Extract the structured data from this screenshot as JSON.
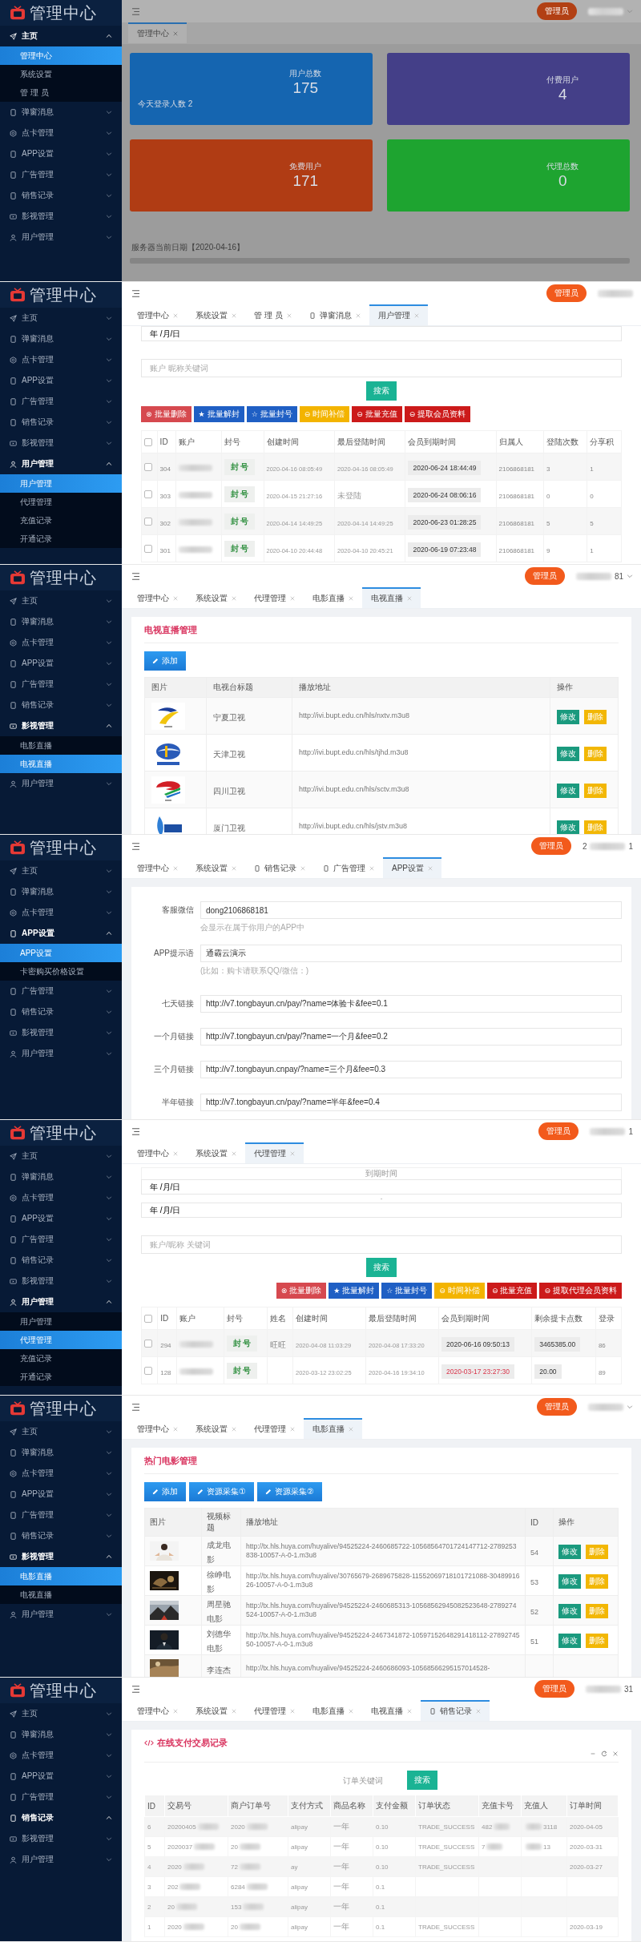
{
  "panels": [
    {
      "kind": "dashboard",
      "sidebar": {
        "logo": "管理中心",
        "items": [
          {
            "label": "主页",
            "expanded": true,
            "children": [
              {
                "label": "管理中心",
                "selected": true
              },
              {
                "label": "系统设置",
                "selected": false
              },
              {
                "label": "管 理 员",
                "selected": false
              }
            ]
          },
          {
            "label": "弹窗消息",
            "expanded": false
          },
          {
            "label": "点卡管理",
            "expanded": false
          },
          {
            "label": "APP设置",
            "expanded": false
          },
          {
            "label": "广告管理",
            "expanded": false
          },
          {
            "label": "销售记录",
            "expanded": false
          },
          {
            "label": "影视管理",
            "expanded": false
          },
          {
            "label": "用户管理",
            "expanded": false
          }
        ]
      },
      "header": {
        "role": "管理员",
        "dropdown": true
      },
      "tabs": [
        {
          "label": "管理中心",
          "selected": true,
          "has_icon": false
        }
      ],
      "body": {
        "stats": [
          {
            "label": "用户总数",
            "value": "175",
            "color": "#1565b0",
            "note": "今天登录人数 2"
          },
          {
            "label": "付费用户",
            "value": "4",
            "color": "#443f88"
          },
          {
            "label": "免费用户",
            "value": "171",
            "color": "#b03c14"
          },
          {
            "label": "代理总数",
            "value": "0",
            "color": "#1ea430"
          }
        ],
        "footer": "服务器当前日期【2020-04-16】"
      }
    },
    {
      "kind": "user_list",
      "sidebar": {
        "logo": "管理中心",
        "items": [
          {
            "label": "主页",
            "expanded": false
          },
          {
            "label": "弹窗消息",
            "expanded": false
          },
          {
            "label": "点卡管理",
            "expanded": false
          },
          {
            "label": "APP设置",
            "expanded": false
          },
          {
            "label": "广告管理",
            "expanded": false
          },
          {
            "label": "销售记录",
            "expanded": false
          },
          {
            "label": "影视管理",
            "expanded": false
          },
          {
            "label": "用户管理",
            "expanded": true,
            "children": [
              {
                "label": "用户管理",
                "selected": true
              },
              {
                "label": "代理管理",
                "selected": false
              },
              {
                "label": "充值记录",
                "selected": false
              },
              {
                "label": "开通记录",
                "selected": false
              }
            ]
          }
        ]
      },
      "header": {
        "role": "管理员",
        "dropdown": false
      },
      "tabs": [
        {
          "label": "管理中心",
          "selected": false,
          "has_icon": false
        },
        {
          "label": "系统设置",
          "selected": false,
          "has_icon": false
        },
        {
          "label": "管 理 员",
          "selected": false,
          "has_icon": false
        },
        {
          "label": "弹窗消息",
          "selected": false,
          "has_icon": true
        },
        {
          "label": "用户管理",
          "selected": true,
          "has_icon": false
        }
      ],
      "body": {
        "date_from": "年 /月/日",
        "keyword_placeholder": "账户 昵称关键词",
        "search": "搜索",
        "batch": [
          {
            "glyph": "⊗",
            "label": "批量删除",
            "color": "#d6494f"
          },
          {
            "glyph": "★",
            "label": "批量解封",
            "color": "#1f5fc4"
          },
          {
            "glyph": "☆",
            "label": "批量封号",
            "color": "#1f5fc4"
          },
          {
            "glyph": "⊖",
            "label": "时间补偿",
            "color": "#f3b400"
          },
          {
            "glyph": "⊖",
            "label": "批量充值",
            "color": "#cc1a1a"
          },
          {
            "glyph": "⊖",
            "label": "提取会员资料",
            "color": "#cc1a1a"
          }
        ],
        "all_checked": false,
        "columns": [
          "ID",
          "账户",
          "封号",
          "创建时间",
          "最后登陆时间",
          "会员到期时间",
          "归属人",
          "登陆次数",
          "分享积"
        ],
        "rows": [
          {
            "checked": false,
            "id": "304",
            "ban": "封 号",
            "created": "2020-04-16 08:05:49",
            "last_login": "2020-04-16 08:05:49",
            "expires": "2020-06-24 18:44:49",
            "expired": false,
            "owner": "2106868181",
            "logins": "3",
            "share": "1"
          },
          {
            "checked": false,
            "id": "303",
            "ban": "封 号",
            "created": "2020-04-15 21:27:16",
            "last_login": "未登陆",
            "expires": "2020-06-24 08:06:16",
            "expired": false,
            "owner": "2106868181",
            "logins": "0",
            "share": "0"
          },
          {
            "checked": false,
            "id": "302",
            "ban": "封 号",
            "created": "2020-04-14 14:49:25",
            "last_login": "2020-04-14 14:49:25",
            "expires": "2020-06-23 01:28:25",
            "expired": false,
            "owner": "2106868181",
            "logins": "5",
            "share": "5"
          },
          {
            "checked": false,
            "id": "301",
            "ban": "封 号",
            "created": "2020-04-10 20:44:48",
            "last_login": "2020-04-10 20:45:21",
            "expires": "2020-06-19 07:23:48",
            "expired": false,
            "owner": "2106868181",
            "logins": "9",
            "share": "1"
          }
        ]
      }
    },
    {
      "kind": "media_list",
      "sidebar": {
        "logo": "管理中心",
        "items": [
          {
            "label": "主页",
            "expanded": false
          },
          {
            "label": "弹窗消息",
            "expanded": false
          },
          {
            "label": "点卡管理",
            "expanded": false
          },
          {
            "label": "APP设置",
            "expanded": false
          },
          {
            "label": "广告管理",
            "expanded": false
          },
          {
            "label": "销售记录",
            "expanded": false
          },
          {
            "label": "影视管理",
            "expanded": true,
            "children": [
              {
                "label": "电影直播",
                "selected": false
              },
              {
                "label": "电视直播",
                "selected": true
              }
            ]
          },
          {
            "label": "用户管理",
            "expanded": false
          }
        ]
      },
      "header": {
        "role": "管理员",
        "user_suffix": "81",
        "dropdown": true
      },
      "tabs": [
        {
          "label": "管理中心",
          "selected": false,
          "has_icon": false
        },
        {
          "label": "系统设置",
          "selected": false,
          "has_icon": false
        },
        {
          "label": "代理管理",
          "selected": false,
          "has_icon": false
        },
        {
          "label": "电影直播",
          "selected": false,
          "has_icon": false
        },
        {
          "label": "电视直播",
          "selected": true,
          "has_icon": false
        }
      ],
      "body": {
        "title": "电视直播管理",
        "buttons": [
          "添加"
        ],
        "columns": [
          "图片",
          "电视台标题",
          "播放地址",
          "操作"
        ],
        "rows": [
          {
            "name": "宁夏卫视",
            "url": "http://ivi.bupt.edu.cn/hls/nxtv.m3u8",
            "edit": "修改",
            "delete": "删除"
          },
          {
            "name": "天津卫视",
            "url": "http://ivi.bupt.edu.cn/hls/tjhd.m3u8",
            "edit": "修改",
            "delete": "删除"
          },
          {
            "name": "四川卫视",
            "url": "http://ivi.bupt.edu.cn/hls/sctv.m3u8",
            "edit": "修改",
            "delete": "删除"
          },
          {
            "name": "厦门卫视",
            "url": "http://ivi.bupt.edu.cn/hls/jstv.m3u8",
            "edit": "修改",
            "delete": "删除"
          }
        ]
      }
    },
    {
      "kind": "app_settings",
      "sidebar": {
        "logo": "管理中心",
        "items": [
          {
            "label": "主页",
            "expanded": false
          },
          {
            "label": "弹窗消息",
            "expanded": false
          },
          {
            "label": "点卡管理",
            "expanded": false
          },
          {
            "label": "APP设置",
            "expanded": true,
            "children": [
              {
                "label": "APP设置",
                "selected": true
              },
              {
                "label": "卡密购买价格设置",
                "selected": false
              }
            ]
          },
          {
            "label": "广告管理",
            "expanded": false
          },
          {
            "label": "销售记录",
            "expanded": false
          },
          {
            "label": "影视管理",
            "expanded": false
          },
          {
            "label": "用户管理",
            "expanded": false
          }
        ]
      },
      "header": {
        "role": "管理员",
        "user_prefix": "2",
        "user_suffix": "1",
        "dropdown": false
      },
      "tabs": [
        {
          "label": "管理中心",
          "selected": false,
          "has_icon": false
        },
        {
          "label": "系统设置",
          "selected": false,
          "has_icon": false
        },
        {
          "label": "销售记录",
          "selected": false,
          "has_icon": true
        },
        {
          "label": "广告管理",
          "selected": false,
          "has_icon": true
        },
        {
          "label": "APP设置",
          "selected": true,
          "has_icon": false
        }
      ],
      "body": {
        "fields": [
          {
            "label": "客服微信",
            "value": "dong2106868181",
            "hint": "会显示在属于你用户的APP中"
          },
          {
            "label": "APP提示语",
            "value": "通霸云演示",
            "hint": "(比如：购卡请联系QQ/微信：)"
          },
          {
            "label": "七天链接",
            "value": "http://v7.tongbayun.cn/pay/?name=体验卡&fee=0.1"
          },
          {
            "label": "一个月链接",
            "value": "http://v7.tongbayun.cn/pay/?name=一个月&fee=0.2"
          },
          {
            "label": "三个月链接",
            "value": "http://v7.tongbayun.cnpay/?name=三个月&fee=0.3"
          },
          {
            "label": "半年链接",
            "value": "http://v7.tongbayun.cn/pay/?name=半年&fee=0.4"
          }
        ]
      }
    },
    {
      "kind": "agent_list",
      "sidebar": {
        "logo": "管理中心",
        "items": [
          {
            "label": "主页",
            "expanded": false
          },
          {
            "label": "弹窗消息",
            "expanded": false
          },
          {
            "label": "点卡管理",
            "expanded": false
          },
          {
            "label": "APP设置",
            "expanded": false
          },
          {
            "label": "广告管理",
            "expanded": false
          },
          {
            "label": "销售记录",
            "expanded": false
          },
          {
            "label": "影视管理",
            "expanded": false
          },
          {
            "label": "用户管理",
            "expanded": true,
            "children": [
              {
                "label": "用户管理",
                "selected": false
              },
              {
                "label": "代理管理",
                "selected": true
              },
              {
                "label": "充值记录",
                "selected": false
              },
              {
                "label": "开通记录",
                "selected": false
              }
            ]
          }
        ]
      },
      "header": {
        "role": "管理员",
        "user_suffix": "1",
        "dropdown": false
      },
      "tabs": [
        {
          "label": "管理中心",
          "selected": false,
          "has_icon": false
        },
        {
          "label": "系统设置",
          "selected": false,
          "has_icon": false
        },
        {
          "label": "代理管理",
          "selected": true,
          "has_icon": false
        }
      ],
      "body": {
        "expiry_label": "到期时间",
        "date_from": "年 /月/日",
        "separator": "-",
        "date_to": "年 /月/日",
        "keyword_placeholder": "账户/昵称 关键词",
        "search": "搜索",
        "batch": [
          {
            "glyph": "⊗",
            "label": "批量删除",
            "color": "#d6494f"
          },
          {
            "glyph": "★",
            "label": "批量解封",
            "color": "#1f5fc4"
          },
          {
            "glyph": "☆",
            "label": "批量封号",
            "color": "#1f5fc4"
          },
          {
            "glyph": "⊖",
            "label": "时间补偿",
            "color": "#f3b400"
          },
          {
            "glyph": "⊖",
            "label": "批量充值",
            "color": "#cc1a1a"
          },
          {
            "glyph": "⊖",
            "label": "提取代理会员资料",
            "color": "#cc1a1a"
          }
        ],
        "all_checked": false,
        "columns": [
          "ID",
          "账户",
          "封号",
          "姓名",
          "创建时间",
          "最后登陆时间",
          "会员到期时间",
          "剩余提卡点数",
          "登录"
        ],
        "rows": [
          {
            "checked": false,
            "id": "294",
            "ban": "封 号",
            "name": "旺旺",
            "created": "2020-04-08 11:03:29",
            "last_login": "2020-04-08 17:33:20",
            "expires": "2020-06-16 09:50:13",
            "expired": false,
            "points": "3465385.00",
            "logins": "86"
          },
          {
            "checked": false,
            "id": "128",
            "ban": "封 号",
            "created": "2020-03-12 23:02:25",
            "last_login": "2020-04-16 19:34:10",
            "expires": "2020-03-17 23:27:30",
            "expired": true,
            "points": "20.00",
            "logins": "89"
          }
        ]
      }
    },
    {
      "kind": "media_list",
      "sidebar": {
        "logo": "管理中心",
        "items": [
          {
            "label": "主页",
            "expanded": false
          },
          {
            "label": "弹窗消息",
            "expanded": false
          },
          {
            "label": "点卡管理",
            "expanded": false
          },
          {
            "label": "APP设置",
            "expanded": false
          },
          {
            "label": "广告管理",
            "expanded": false
          },
          {
            "label": "销售记录",
            "expanded": false
          },
          {
            "label": "影视管理",
            "expanded": true,
            "children": [
              {
                "label": "电影直播",
                "selected": true
              },
              {
                "label": "电视直播",
                "selected": false
              }
            ]
          },
          {
            "label": "用户管理",
            "expanded": false
          }
        ]
      },
      "header": {
        "role": "管理员",
        "dropdown": true
      },
      "tabs": [
        {
          "label": "管理中心",
          "selected": false,
          "has_icon": false
        },
        {
          "label": "系统设置",
          "selected": false,
          "has_icon": false
        },
        {
          "label": "代理管理",
          "selected": false,
          "has_icon": false
        },
        {
          "label": "电影直播",
          "selected": true,
          "has_icon": false
        }
      ],
      "body": {
        "title": "热门电影管理",
        "buttons": [
          "添加",
          "资源采集①",
          "资源采集②"
        ],
        "columns": [
          "图片",
          "视频标题",
          "播放地址",
          "ID",
          "操作"
        ],
        "rows": [
          {
            "name": "成龙电影",
            "url": "http://tx.hls.huya.com/huyalive/94525224-2460685722-10568564701724147712-2789253838-10057-A-0-1.m3u8",
            "id": "54",
            "edit": "修改",
            "delete": "删除"
          },
          {
            "name": "徐峥电影",
            "url": "http://tx.hls.huya.com/huyalive/30765679-2689675828-11552069718101721088-3048991626-10057-A-0-1.m3u8",
            "id": "53",
            "edit": "修改",
            "delete": "删除"
          },
          {
            "name": "周星驰电影",
            "url": "http://tx.hls.huya.com/huyalive/94525224-2460685313-10568562945082523648-2789274524-10057-A-0-1.m3u8",
            "id": "52",
            "edit": "修改",
            "delete": "删除"
          },
          {
            "name": "刘德华电影",
            "url": "http://tx.hls.huya.com/huyalive/94525224-2467341872-10597152648291418112-2789274550-10057-A-0-1.m3u8",
            "id": "51",
            "edit": "修改",
            "delete": "删除"
          },
          {
            "name": "李连杰",
            "url": "http://tx.hls.huya.com/huyalive/94525224-2460686093-10568566295157014528-"
          }
        ]
      }
    },
    {
      "kind": "sales",
      "sidebar": {
        "logo": "管理中心",
        "items": [
          {
            "label": "主页",
            "expanded": false
          },
          {
            "label": "弹窗消息",
            "expanded": false
          },
          {
            "label": "点卡管理",
            "expanded": false
          },
          {
            "label": "APP设置",
            "expanded": false
          },
          {
            "label": "广告管理",
            "expanded": false
          },
          {
            "label": "销售记录",
            "expanded": true
          },
          {
            "label": "影视管理",
            "expanded": false
          },
          {
            "label": "用户管理",
            "expanded": false
          }
        ]
      },
      "header": {
        "role": "管理员",
        "user_suffix": "31",
        "dropdown": false
      },
      "tabs": [
        {
          "label": "管理中心",
          "selected": false,
          "has_icon": false
        },
        {
          "label": "系统设置",
          "selected": false,
          "has_icon": false
        },
        {
          "label": "代理管理",
          "selected": false,
          "has_icon": false
        },
        {
          "label": "电影直播",
          "selected": false,
          "has_icon": false
        },
        {
          "label": "电视直播",
          "selected": false,
          "has_icon": false
        },
        {
          "label": "销售记录",
          "selected": true,
          "has_icon": true
        }
      ],
      "body": {
        "title": "在线支付交易记录",
        "search_placeholder": "订单关键词",
        "search": "搜索",
        "columns": [
          "ID",
          "交易号",
          "商户订单号",
          "支付方式",
          "商品名称",
          "支付金额",
          "订单状态",
          "充值卡号",
          "充值人",
          "订单时间"
        ],
        "rows": [
          {
            "id": "6",
            "trade_no": "20200405",
            "order_no": "2020",
            "method": "alipay",
            "product": "一年",
            "amount": "0.10",
            "status": "TRADE_SUCCESS",
            "card": "482",
            "payer": "3118",
            "time": "2020-04-05"
          },
          {
            "id": "5",
            "trade_no": "2020037",
            "order_no": "20",
            "method": "alipay",
            "product": "一年",
            "amount": "0.10",
            "status": "TRADE_SUCCESS",
            "card": "7",
            "payer": "13",
            "time": "2020-03-31"
          },
          {
            "id": "4",
            "trade_no": "2020",
            "order_no": "72",
            "method": "ay",
            "product": "一年",
            "amount": "0.10",
            "status": "TRADE_SUCCESS",
            "time": "2020-03-27"
          },
          {
            "id": "3",
            "trade_no": "202",
            "order_no": "6284",
            "method": "alipay",
            "product": "一年",
            "amount": "0.1"
          },
          {
            "id": "2",
            "trade_no": "20",
            "order_no": "153",
            "method": "alipay",
            "product": "一年",
            "amount": "0.1"
          },
          {
            "id": "1",
            "trade_no": "2020",
            "order_no": "20",
            "method": "alipay",
            "product": "一年",
            "amount": "0.1",
            "status": "TRADE_SUCCESS",
            "time": "2020-03-19"
          }
        ]
      }
    }
  ]
}
